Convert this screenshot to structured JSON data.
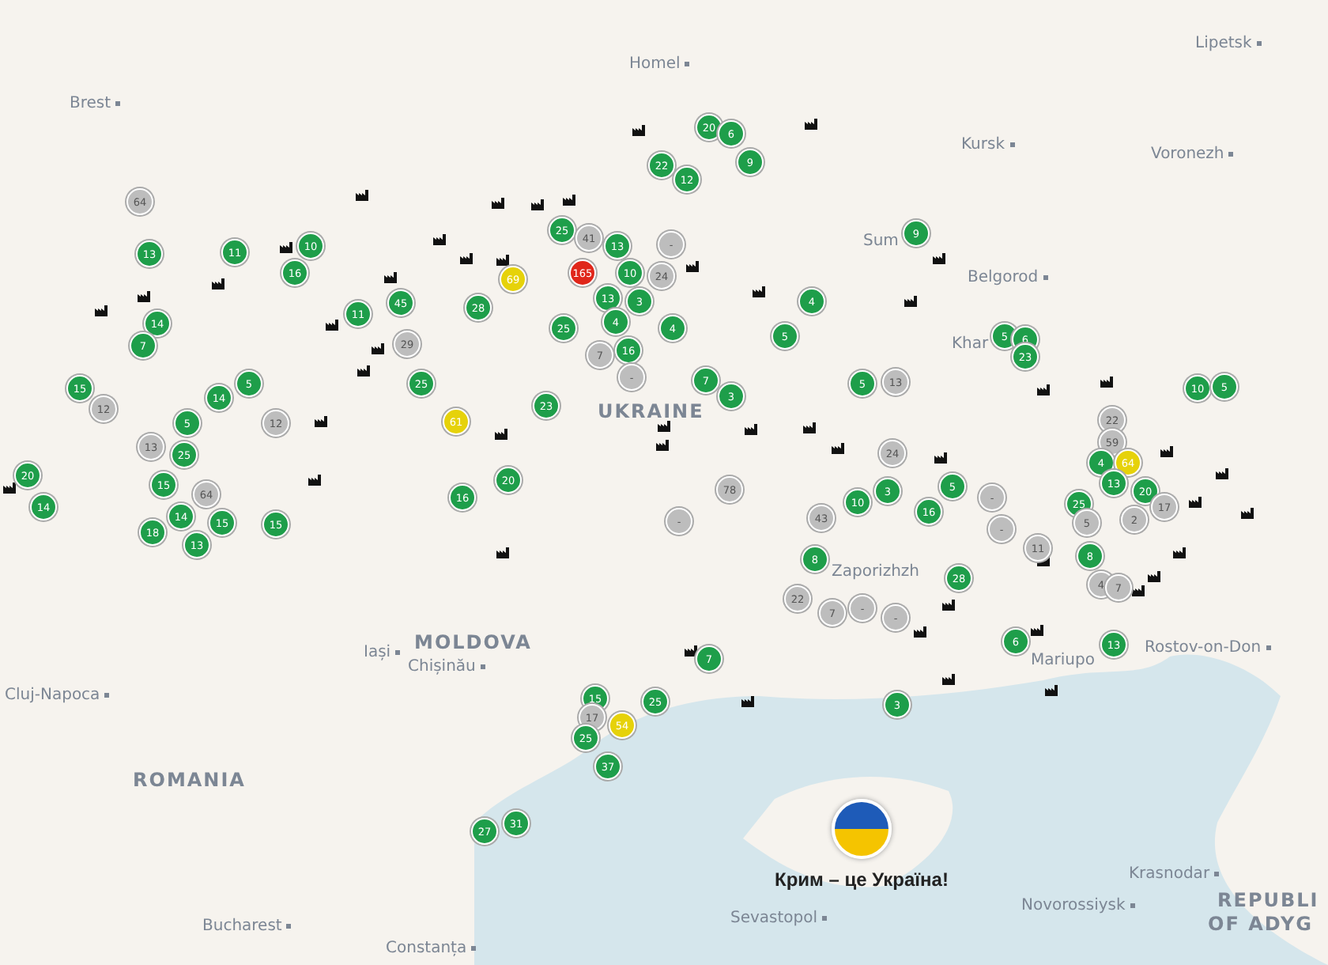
{
  "map_labels": [
    {
      "text": "Lipetsk",
      "kind": "city"
    },
    {
      "text": "Homel",
      "kind": "city"
    },
    {
      "text": "Brest",
      "kind": "city"
    },
    {
      "text": "Kursk",
      "kind": "city"
    },
    {
      "text": "Voronezh",
      "kind": "city"
    },
    {
      "text": "Sum",
      "kind": "place"
    },
    {
      "text": "Belgorod",
      "kind": "city"
    },
    {
      "text": "Khar",
      "kind": "place"
    },
    {
      "text": "UKRAINE",
      "kind": "country"
    },
    {
      "text": "Zaporizhzh",
      "kind": "place"
    },
    {
      "text": "Iași",
      "kind": "city"
    },
    {
      "text": "MOLDOVA",
      "kind": "country"
    },
    {
      "text": "Chișinău",
      "kind": "city"
    },
    {
      "text": "Mariupo",
      "kind": "place"
    },
    {
      "text": "Rostov-on-Don",
      "kind": "city"
    },
    {
      "text": "Cluj-Napoca",
      "kind": "city"
    },
    {
      "text": "ROMANIA",
      "kind": "country"
    },
    {
      "text": "Krasnodar",
      "kind": "city"
    },
    {
      "text": "Novorossiysk",
      "kind": "city"
    },
    {
      "text": "REPUBLI",
      "kind": "country"
    },
    {
      "text": "Bucharest",
      "kind": "city"
    },
    {
      "text": "Sevastopol",
      "kind": "city"
    },
    {
      "text": "OF ADYG",
      "kind": "country"
    },
    {
      "text": "Constanța",
      "kind": "city"
    }
  ],
  "markers": [
    {
      "label": "64",
      "color": "#bdbdbd"
    },
    {
      "label": "13",
      "color": "#1e9e4a"
    },
    {
      "label": "11",
      "color": "#1e9e4a"
    },
    {
      "label": "10",
      "color": "#1e9e4a"
    },
    {
      "label": "16",
      "color": "#1e9e4a"
    },
    {
      "label": "11",
      "color": "#1e9e4a"
    },
    {
      "label": "45",
      "color": "#1e9e4a"
    },
    {
      "label": "29",
      "color": "#bdbdbd"
    },
    {
      "label": "28",
      "color": "#1e9e4a"
    },
    {
      "label": "25",
      "color": "#1e9e4a"
    },
    {
      "label": "14",
      "color": "#1e9e4a"
    },
    {
      "label": "7",
      "color": "#1e9e4a"
    },
    {
      "label": "15",
      "color": "#1e9e4a"
    },
    {
      "label": "12",
      "color": "#bdbdbd"
    },
    {
      "label": "14",
      "color": "#1e9e4a"
    },
    {
      "label": "5",
      "color": "#1e9e4a"
    },
    {
      "label": "5",
      "color": "#1e9e4a"
    },
    {
      "label": "13",
      "color": "#bdbdbd"
    },
    {
      "label": "12",
      "color": "#bdbdbd"
    },
    {
      "label": "25",
      "color": "#1e9e4a"
    },
    {
      "label": "20",
      "color": "#1e9e4a"
    },
    {
      "label": "14",
      "color": "#1e9e4a"
    },
    {
      "label": "15",
      "color": "#1e9e4a"
    },
    {
      "label": "64",
      "color": "#bdbdbd"
    },
    {
      "label": "18",
      "color": "#1e9e4a"
    },
    {
      "label": "14",
      "color": "#1e9e4a"
    },
    {
      "label": "15",
      "color": "#1e9e4a"
    },
    {
      "label": "13",
      "color": "#1e9e4a"
    },
    {
      "label": "15",
      "color": "#1e9e4a"
    },
    {
      "label": "20",
      "color": "#1e9e4a"
    },
    {
      "label": "6",
      "color": "#1e9e4a"
    },
    {
      "label": "22",
      "color": "#1e9e4a"
    },
    {
      "label": "12",
      "color": "#1e9e4a"
    },
    {
      "label": "9",
      "color": "#1e9e4a"
    },
    {
      "label": "25",
      "color": "#1e9e4a"
    },
    {
      "label": "41",
      "color": "#bdbdbd"
    },
    {
      "label": "13",
      "color": "#1e9e4a"
    },
    {
      "label": "-",
      "color": "#bdbdbd"
    },
    {
      "label": "69",
      "color": "#e6d20a"
    },
    {
      "label": "165",
      "color": "#e0261a"
    },
    {
      "label": "13",
      "color": "#1e9e4a"
    },
    {
      "label": "10",
      "color": "#1e9e4a"
    },
    {
      "label": "24",
      "color": "#bdbdbd"
    },
    {
      "label": "3",
      "color": "#1e9e4a"
    },
    {
      "label": "25",
      "color": "#1e9e4a"
    },
    {
      "label": "4",
      "color": "#1e9e4a"
    },
    {
      "label": "4",
      "color": "#1e9e4a"
    },
    {
      "label": "7",
      "color": "#bdbdbd"
    },
    {
      "label": "16",
      "color": "#1e9e4a"
    },
    {
      "label": "4",
      "color": "#1e9e4a"
    },
    {
      "label": "5",
      "color": "#1e9e4a"
    },
    {
      "label": "-",
      "color": "#bdbdbd"
    },
    {
      "label": "7",
      "color": "#1e9e4a"
    },
    {
      "label": "3",
      "color": "#1e9e4a"
    },
    {
      "label": "23",
      "color": "#1e9e4a"
    },
    {
      "label": "61",
      "color": "#e6d20a"
    },
    {
      "label": "20",
      "color": "#1e9e4a"
    },
    {
      "label": "16",
      "color": "#1e9e4a"
    },
    {
      "label": "9",
      "color": "#1e9e4a"
    },
    {
      "label": "5",
      "color": "#1e9e4a"
    },
    {
      "label": "13",
      "color": "#bdbdbd"
    },
    {
      "label": "5",
      "color": "#1e9e4a"
    },
    {
      "label": "6",
      "color": "#1e9e4a"
    },
    {
      "label": "23",
      "color": "#1e9e4a"
    },
    {
      "label": "10",
      "color": "#1e9e4a"
    },
    {
      "label": "5",
      "color": "#1e9e4a"
    },
    {
      "label": "22",
      "color": "#bdbdbd"
    },
    {
      "label": "59",
      "color": "#bdbdbd"
    },
    {
      "label": "4",
      "color": "#1e9e4a"
    },
    {
      "label": "64",
      "color": "#e6d20a"
    },
    {
      "label": "13",
      "color": "#1e9e4a"
    },
    {
      "label": "25",
      "color": "#1e9e4a"
    },
    {
      "label": "20",
      "color": "#1e9e4a"
    },
    {
      "label": "17",
      "color": "#bdbdbd"
    },
    {
      "label": "2",
      "color": "#bdbdbd"
    },
    {
      "label": "5",
      "color": "#bdbdbd"
    },
    {
      "label": "24",
      "color": "#bdbdbd"
    },
    {
      "label": "10",
      "color": "#1e9e4a"
    },
    {
      "label": "3",
      "color": "#1e9e4a"
    },
    {
      "label": "5",
      "color": "#1e9e4a"
    },
    {
      "label": "16",
      "color": "#1e9e4a"
    },
    {
      "label": "43",
      "color": "#bdbdbd"
    },
    {
      "label": "11",
      "color": "#bdbdbd"
    },
    {
      "label": "-",
      "color": "#bdbdbd"
    },
    {
      "label": "-",
      "color": "#bdbdbd"
    },
    {
      "label": "8",
      "color": "#1e9e4a"
    },
    {
      "label": "4",
      "color": "#bdbdbd"
    },
    {
      "label": "7",
      "color": "#bdbdbd"
    },
    {
      "label": "8",
      "color": "#1e9e4a"
    },
    {
      "label": "22",
      "color": "#bdbdbd"
    },
    {
      "label": "7",
      "color": "#bdbdbd"
    },
    {
      "label": "-",
      "color": "#bdbdbd"
    },
    {
      "label": "-",
      "color": "#bdbdbd"
    },
    {
      "label": "28",
      "color": "#1e9e4a"
    },
    {
      "label": "6",
      "color": "#1e9e4a"
    },
    {
      "label": "13",
      "color": "#1e9e4a"
    },
    {
      "label": "78",
      "color": "#bdbdbd"
    },
    {
      "label": "-",
      "color": "#bdbdbd"
    },
    {
      "label": "7",
      "color": "#1e9e4a"
    },
    {
      "label": "15",
      "color": "#1e9e4a"
    },
    {
      "label": "17",
      "color": "#bdbdbd"
    },
    {
      "label": "54",
      "color": "#e6d20a"
    },
    {
      "label": "25",
      "color": "#1e9e4a"
    },
    {
      "label": "25",
      "color": "#1e9e4a"
    },
    {
      "label": "37",
      "color": "#1e9e4a"
    },
    {
      "label": "3",
      "color": "#1e9e4a"
    },
    {
      "label": "27",
      "color": "#1e9e4a"
    },
    {
      "label": "31",
      "color": "#1e9e4a"
    }
  ],
  "crimea_badge": {
    "caption": "Крим – це Україна!"
  }
}
